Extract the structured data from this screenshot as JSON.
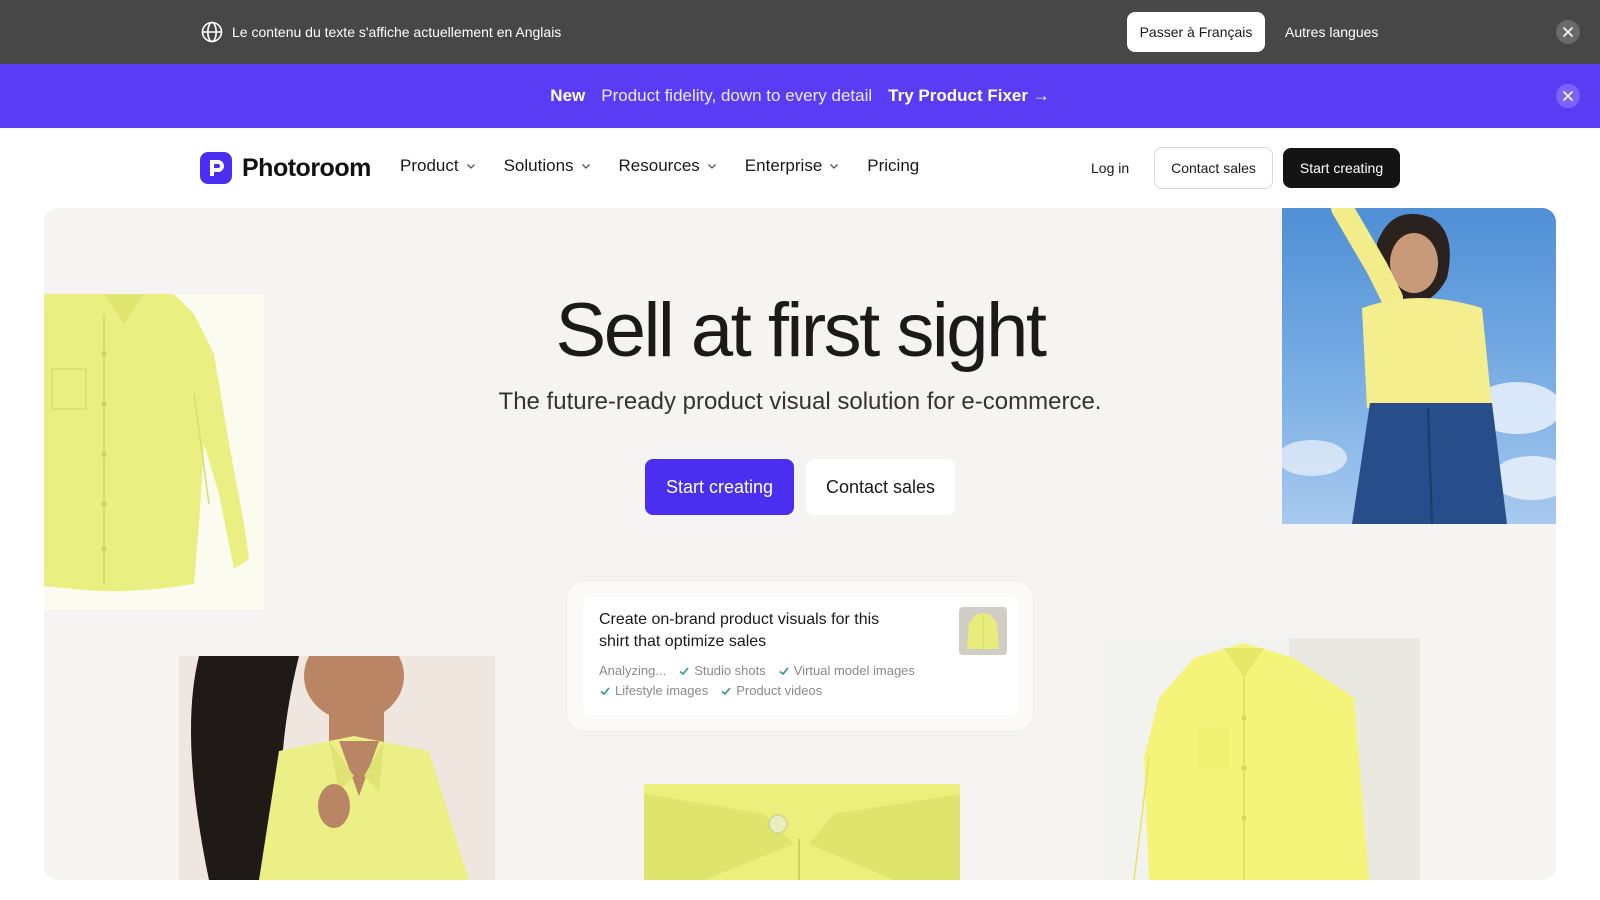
{
  "language_bar": {
    "message": "Le contenu du texte s'affiche actuellement en Anglais",
    "switch_button": "Passer à Français",
    "other_languages": "Autres langues"
  },
  "promo_bar": {
    "badge": "New",
    "text": "Product fidelity, down to every detail",
    "link": "Try Product Fixer →"
  },
  "nav": {
    "brand": "Photoroom",
    "menu": [
      {
        "label": "Product"
      },
      {
        "label": "Solutions"
      },
      {
        "label": "Resources"
      },
      {
        "label": "Enterprise"
      },
      {
        "label": "Pricing"
      }
    ],
    "login": "Log in",
    "contact_sales": "Contact sales",
    "start_creating": "Start creating"
  },
  "hero": {
    "title": "Sell at first sight",
    "subtitle": "The future-ready product visual solution for e-commerce.",
    "cta_primary": "Start creating",
    "cta_secondary": "Contact sales"
  },
  "prompt_card": {
    "text": "Create on-brand product visuals for this shirt that optimize sales",
    "status": "Analyzing...",
    "items": [
      "Studio shots",
      "Virtual model images",
      "Lifestyle images",
      "Product videos"
    ]
  },
  "colors": {
    "accent": "#4b2ff0",
    "promo_bg": "#5a3cf5",
    "language_bar_bg": "#474747",
    "hero_bg": "#f5f4f2",
    "product_yellow": "#e8ef7e"
  }
}
